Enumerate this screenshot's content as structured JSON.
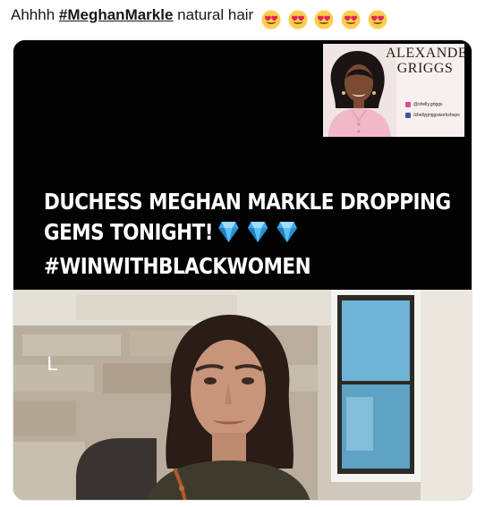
{
  "tweet": {
    "prefix": "Ahhhh ",
    "hashtag": "#MeghanMarkle",
    "suffix": " natural hair",
    "emoji_icon": "heart-eyes-emoji",
    "emoji_count": 5
  },
  "promo": {
    "name_line1": "ALEXANDER",
    "name_line2": "GRIGGS",
    "instagram_handle": "@shelly.griggs",
    "facebook_handle": "/shellygriggsworkshops",
    "brand_color": "#e2498a"
  },
  "headline": {
    "line1": "DUCHESS MEGHAN MARKLE DROPPING",
    "line2": "GEMS TONIGHT!",
    "line3": "#WINWITHBLACKWOMEN",
    "gem_icon": "gem-stone-emoji",
    "gem_count": 3
  },
  "video": {
    "participant_initial": "L"
  },
  "colors": {
    "text": "#14171a",
    "card_background": "#020202",
    "headline_text": "#ffffff",
    "gem_blue": "#3aa9e6"
  }
}
